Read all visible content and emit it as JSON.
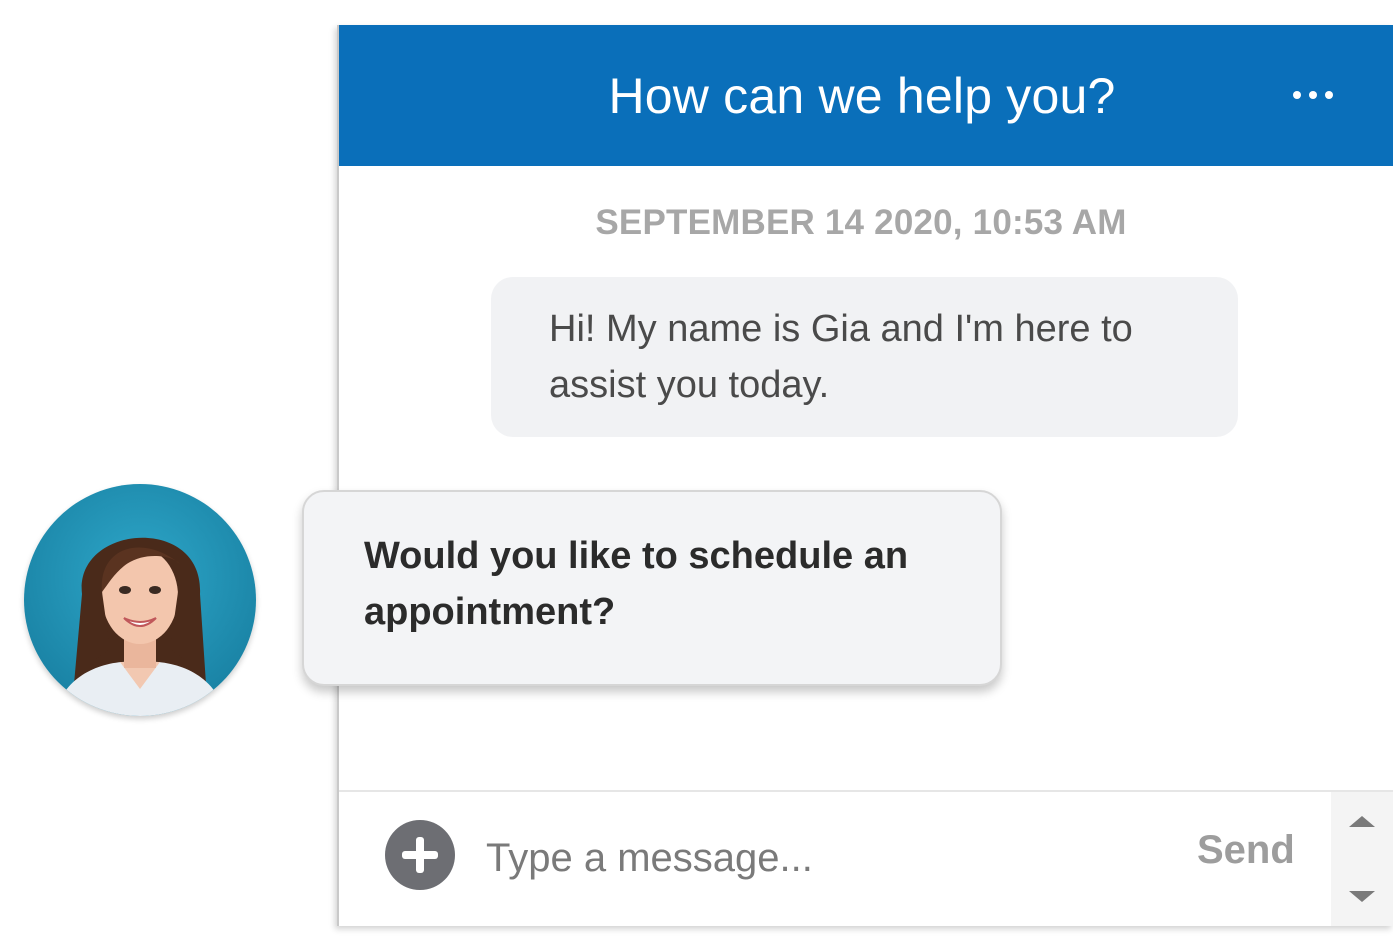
{
  "colors": {
    "header_bg": "#0a6fba",
    "bubble_bg": "#f1f2f4",
    "timestamp": "#a7a7a7",
    "send_label": "#9d9d9d"
  },
  "header": {
    "title": "How can we help you?",
    "menu_icon": "more-horizontal-icon"
  },
  "conversation": {
    "timestamp": "SEPTEMBER 14 2020, 10:53 AM",
    "messages": [
      {
        "sender": "bot",
        "text": "Hi! My name is Gia and I'm here to assist you today."
      }
    ]
  },
  "prompt": {
    "text": "Would you like to schedule an appointment?"
  },
  "composer": {
    "placeholder": "Type a message...",
    "value": "",
    "send_label": "Send",
    "add_icon": "plus-circle-icon"
  },
  "avatar": {
    "icon": "agent-avatar"
  }
}
